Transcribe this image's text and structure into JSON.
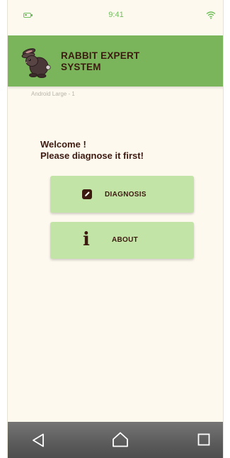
{
  "status_bar": {
    "time": "9:41",
    "battery_icon": "battery-icon",
    "wifi_icon": "wifi-icon",
    "accent_color": "#6fbf5a"
  },
  "header": {
    "title_line1": "RABBIT EXPERT",
    "title_line2": "SYSTEM",
    "logo_icon": "rabbit-icon",
    "background_color": "#7ab55c"
  },
  "frame_label": "Android Large - 1",
  "welcome": {
    "line1": "Welcome !",
    "line2": "Please diagnose it first!"
  },
  "buttons": [
    {
      "label": "DIAGNOSIS",
      "icon": "edit-icon"
    },
    {
      "label": "ABOUT",
      "icon": "info-icon"
    }
  ],
  "button_color": "#c2e4a6",
  "text_color": "#3d1a10",
  "nav_bar": {
    "back_icon": "back-triangle-icon",
    "home_icon": "home-icon",
    "recent_icon": "recent-apps-icon"
  }
}
